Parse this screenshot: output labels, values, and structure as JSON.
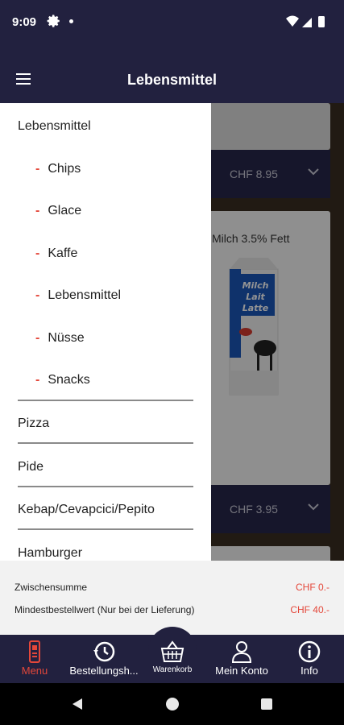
{
  "status": {
    "time": "9:09"
  },
  "header": {
    "title": "Lebensmittel"
  },
  "drawer": {
    "category": "Lebensmittel",
    "subitems": [
      {
        "label": "Chips"
      },
      {
        "label": "Glace"
      },
      {
        "label": "Kaffe"
      },
      {
        "label": "Lebensmittel"
      },
      {
        "label": "Nüsse"
      },
      {
        "label": "Snacks"
      }
    ],
    "dash": "-",
    "categories": [
      {
        "label": "Pizza"
      },
      {
        "label": "Pide"
      },
      {
        "label": "Kebap/Cevapcici/Pepito"
      },
      {
        "label": "Hamburger"
      }
    ]
  },
  "content": {
    "product1": {
      "price": "CHF 8.95"
    },
    "product2": {
      "name": "Milch 3.5% Fett",
      "price": "CHF 3.95",
      "packaging_text": "Milch Lait Latte"
    }
  },
  "summary": {
    "subtotal_label": "Zwischensumme",
    "subtotal_value": "CHF 0.-",
    "minimum_label": "Mindestbestellwert (Nur bei der Lieferung)",
    "minimum_value": "CHF 40.-"
  },
  "bottom_nav": {
    "items": [
      {
        "label": "Menu",
        "icon": "menu-card-icon"
      },
      {
        "label": "Bestellungsh...",
        "icon": "history-icon"
      },
      {
        "label": "Warenkorb",
        "icon": "basket-icon"
      },
      {
        "label": "Mein Konto",
        "icon": "person-icon"
      },
      {
        "label": "Info",
        "icon": "info-icon"
      }
    ]
  },
  "colors": {
    "primary": "#22213f",
    "accent": "#e4473a"
  }
}
